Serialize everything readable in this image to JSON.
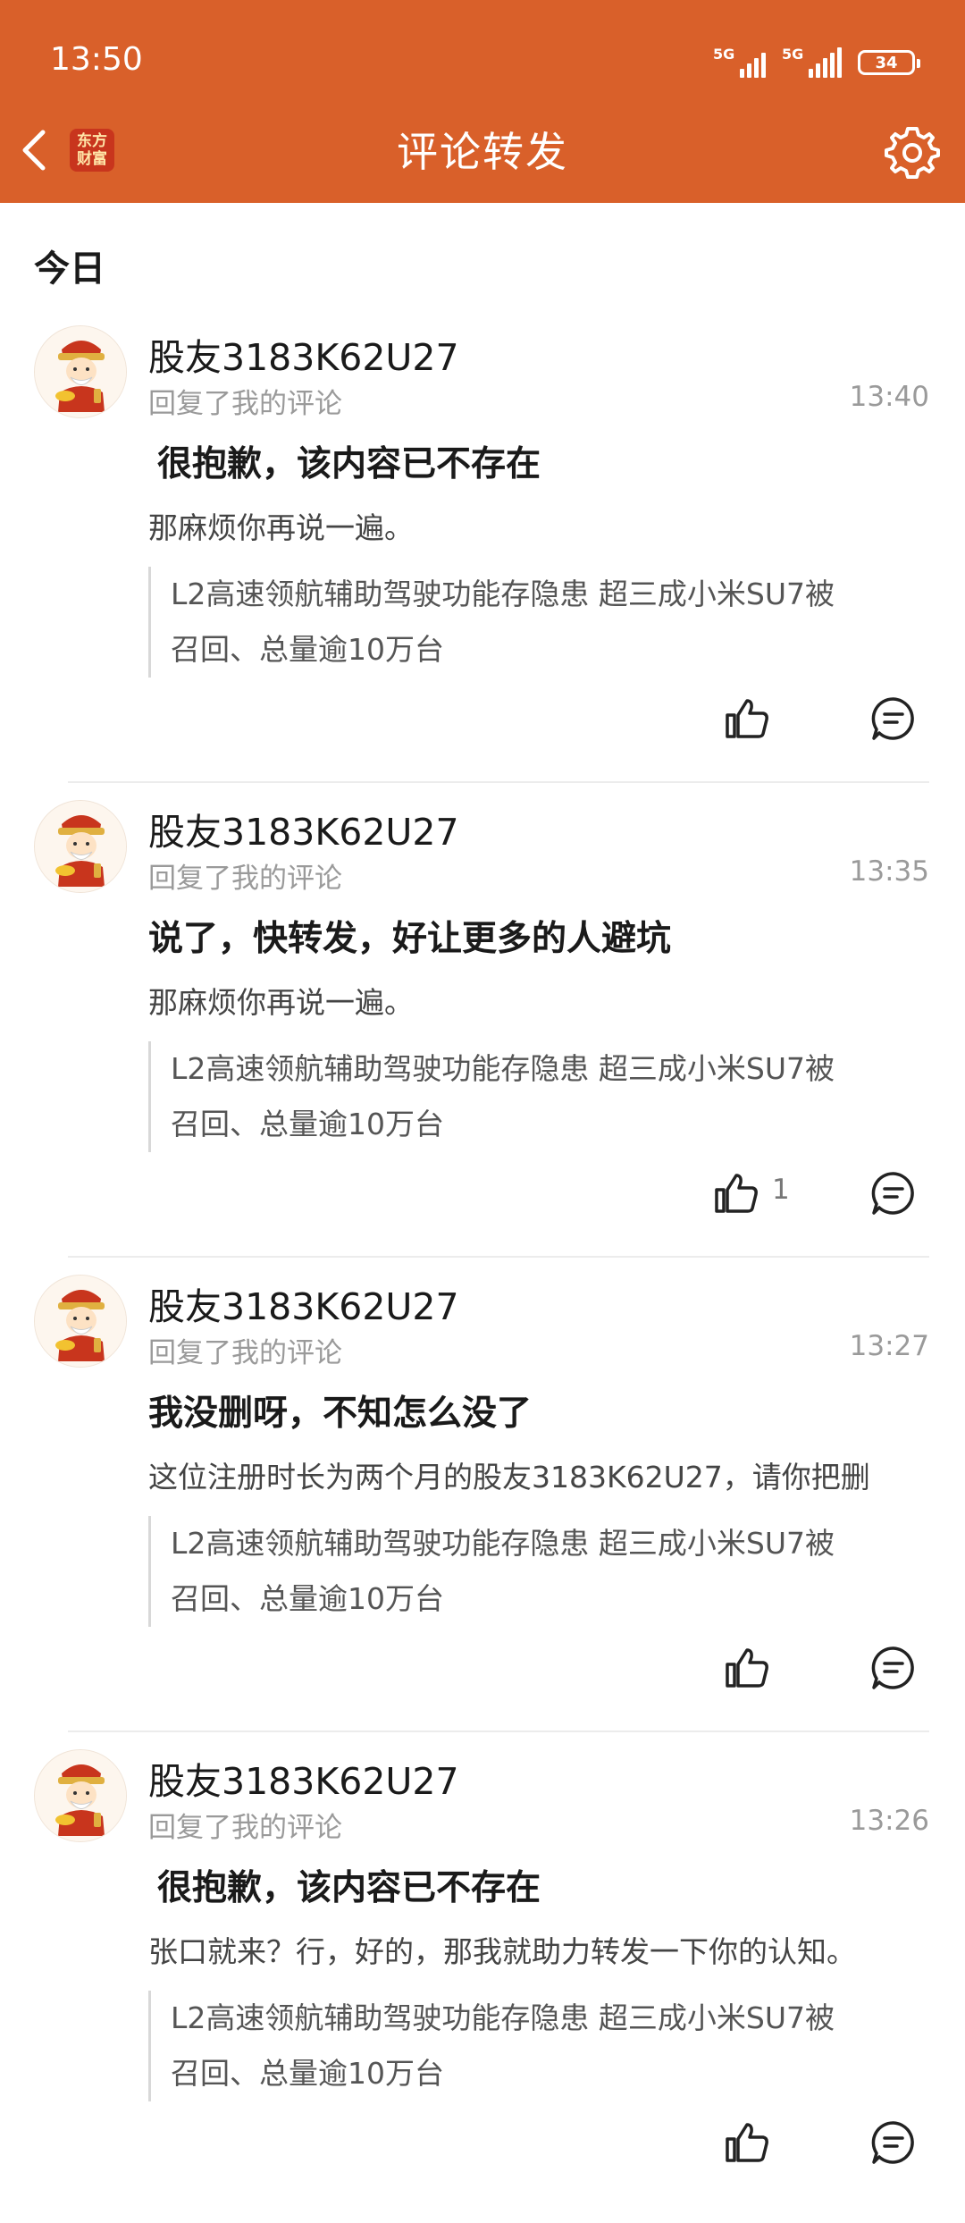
{
  "status_bar": {
    "time": "13:50",
    "signal_1": "5G",
    "signal_2": "5G",
    "battery": "34"
  },
  "header": {
    "title": "评论转发",
    "logo_text_1": "东方",
    "logo_text_2": "财富"
  },
  "section": {
    "title": "今日"
  },
  "items": [
    {
      "username": "股友3183K62U27",
      "subtitle": "回复了我的评论",
      "time": "13:40",
      "reply": "很抱歉，该内容已不存在",
      "my_comment": "那麻烦你再说一遍。",
      "quote_line1": "L2高速领航辅助驾驶功能存隐患 超三成小米SU7被",
      "quote_line2": "召回、总量逾10万台",
      "like_count": ""
    },
    {
      "username": "股友3183K62U27",
      "subtitle": "回复了我的评论",
      "time": "13:35",
      "reply": "说了，快转发，好让更多的人避坑",
      "my_comment": "那麻烦你再说一遍。",
      "quote_line1": "L2高速领航辅助驾驶功能存隐患 超三成小米SU7被",
      "quote_line2": "召回、总量逾10万台",
      "like_count": "1"
    },
    {
      "username": "股友3183K62U27",
      "subtitle": "回复了我的评论",
      "time": "13:27",
      "reply": "我没删呀，不知怎么没了",
      "my_comment": "这位注册时长为两个月的股友3183K62U27，请你把删",
      "quote_line1": "L2高速领航辅助驾驶功能存隐患 超三成小米SU7被",
      "quote_line2": "召回、总量逾10万台",
      "like_count": ""
    },
    {
      "username": "股友3183K62U27",
      "subtitle": "回复了我的评论",
      "time": "13:26",
      "reply": "很抱歉，该内容已不存在",
      "my_comment": "张口就来？行，好的，那我就助力转发一下你的认知。",
      "quote_line1": "L2高速领航辅助驾驶功能存隐患 超三成小米SU7被",
      "quote_line2": "召回、总量逾10万台",
      "like_count": ""
    }
  ]
}
